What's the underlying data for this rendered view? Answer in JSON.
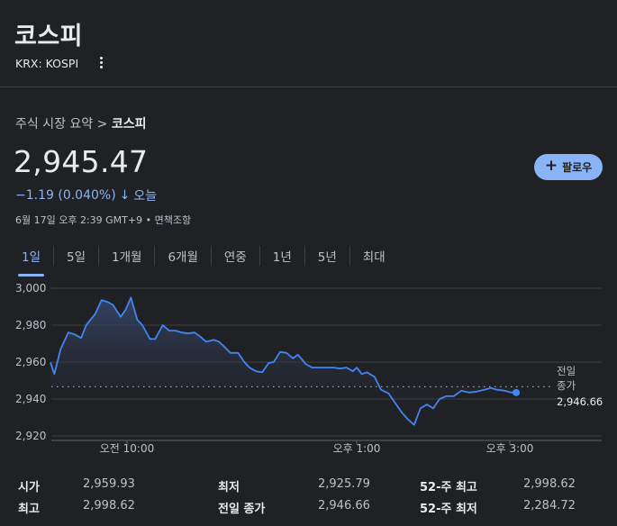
{
  "header": {
    "title": "코스피",
    "ticker": "KRX: KOSPI"
  },
  "breadcrumb": {
    "parent": "주식 시장 요약",
    "separator": ">",
    "current": "코스피"
  },
  "quote": {
    "price": "2,945.47",
    "change": "−1.19 (0.040%)",
    "direction_glyph": "↓",
    "period": "오늘",
    "timestamp": "6월 17일 오후 2:39 GMT+9 • 면책조항",
    "follow_label": "팔로우"
  },
  "tabs": [
    {
      "label": "1일",
      "active": true
    },
    {
      "label": "5일",
      "active": false
    },
    {
      "label": "1개월",
      "active": false
    },
    {
      "label": "6개월",
      "active": false
    },
    {
      "label": "연중",
      "active": false
    },
    {
      "label": "1년",
      "active": false
    },
    {
      "label": "5년",
      "active": false
    },
    {
      "label": "최대",
      "active": false
    }
  ],
  "colors": {
    "accent": "#8ab4f8",
    "line": "#4285f4",
    "background": "#202124"
  },
  "chart_data": {
    "type": "area",
    "y_ticks": [
      "3,000",
      "2,980",
      "2,960",
      "2,940",
      "2,920"
    ],
    "y_tick_values": [
      3000,
      2980,
      2960,
      2940,
      2920
    ],
    "ylim": [
      2918,
      3004
    ],
    "x_ticks": [
      {
        "label": "오전 10:00",
        "minute": 60
      },
      {
        "label": "오후 1:00",
        "minute": 240
      },
      {
        "label": "오후 3:00",
        "minute": 360
      }
    ],
    "x_range_minutes": [
      0,
      390
    ],
    "previous_close": {
      "label_line1": "전일",
      "label_line2": "종가",
      "value_label": "2,946.66",
      "value": 2946.66
    },
    "series": [
      {
        "x": [
          0,
          3,
          8,
          14,
          19,
          24,
          28,
          35,
          40,
          45,
          49,
          55,
          59,
          63,
          68,
          72,
          78,
          82,
          88,
          93,
          98,
          103,
          108,
          113,
          117,
          122,
          128,
          132,
          136,
          141,
          147,
          152,
          156,
          161,
          166,
          171,
          175,
          180,
          185,
          190,
          194,
          200,
          205,
          210,
          216,
          222,
          227,
          232,
          237,
          240,
          244,
          248,
          254,
          259,
          265,
          270,
          275,
          280,
          285,
          290,
          295,
          300,
          305,
          310,
          316,
          322,
          328,
          334,
          340,
          345,
          350,
          356,
          361,
          365
        ],
        "y": [
          2959.9,
          2953.5,
          2967,
          2976,
          2975,
          2973,
          2980,
          2986,
          2993.5,
          2992.5,
          2991,
          2984.5,
          2988.5,
          2995,
          2983,
          2980,
          2972.5,
          2972.5,
          2980,
          2977,
          2977,
          2976,
          2975.5,
          2976,
          2974,
          2971,
          2972,
          2971,
          2968.5,
          2965,
          2965,
          2960,
          2957,
          2955,
          2954.5,
          2959.5,
          2960,
          2965.5,
          2965,
          2962,
          2964,
          2959,
          2957,
          2957,
          2957,
          2957,
          2956.5,
          2957,
          2955,
          2957,
          2953.5,
          2954.5,
          2952,
          2945,
          2943,
          2938,
          2933,
          2929,
          2926,
          2935,
          2937,
          2935,
          2940,
          2941.5,
          2941.5,
          2944.5,
          2943.5,
          2944,
          2945,
          2946,
          2945,
          2944.5,
          2943.5,
          2943.5
        ]
      }
    ],
    "last_point": {
      "minute": 365,
      "value": 2943.5
    }
  },
  "stats": [
    {
      "label": "시가",
      "value": "2,959.93"
    },
    {
      "label": "최저",
      "value": "2,925.79"
    },
    {
      "label": "52-주 최고",
      "value": "2,998.62"
    },
    {
      "label": "최고",
      "value": "2,998.62"
    },
    {
      "label": "전일 종가",
      "value": "2,946.66"
    },
    {
      "label": "52-주 최저",
      "value": "2,284.72"
    }
  ]
}
